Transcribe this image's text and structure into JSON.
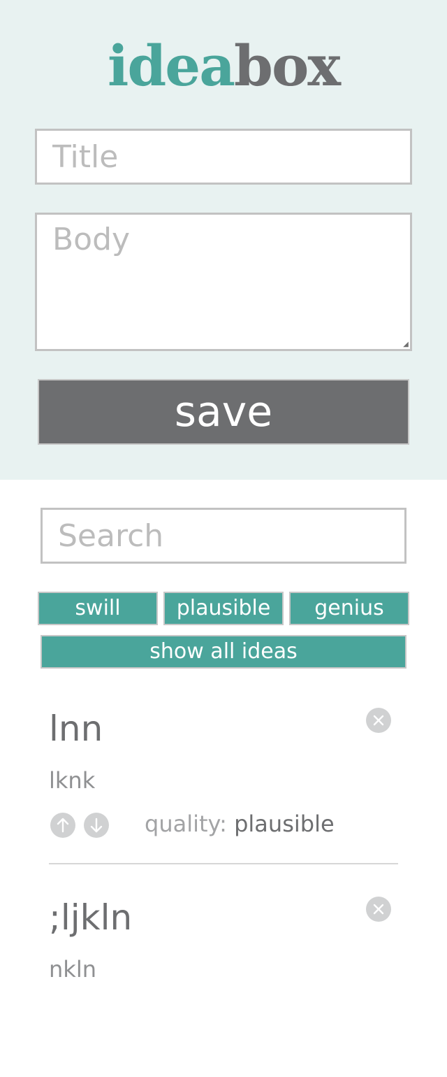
{
  "header": {
    "logo_part_a": "idea",
    "logo_part_b": "box",
    "title_placeholder": "Title",
    "body_placeholder": "Body",
    "save_label": "save"
  },
  "search": {
    "placeholder": "Search"
  },
  "filters": {
    "swill": "swill",
    "plausible": "plausible",
    "genius": "genius",
    "show_all": "show all ideas"
  },
  "ideas": [
    {
      "title": "lnn",
      "body": "lknk",
      "quality_label": "quality: ",
      "quality_value": "plausible"
    },
    {
      "title": ";ljkln",
      "body": "nkln"
    }
  ],
  "icons": {
    "delete": "close-icon",
    "upvote": "arrow-up-icon",
    "downvote": "arrow-down-icon"
  },
  "colors": {
    "accent": "#4aa59b",
    "dark_gray": "#6d6e70",
    "header_bg": "#e8f2f1",
    "icon_bg": "#d0d1d2"
  }
}
